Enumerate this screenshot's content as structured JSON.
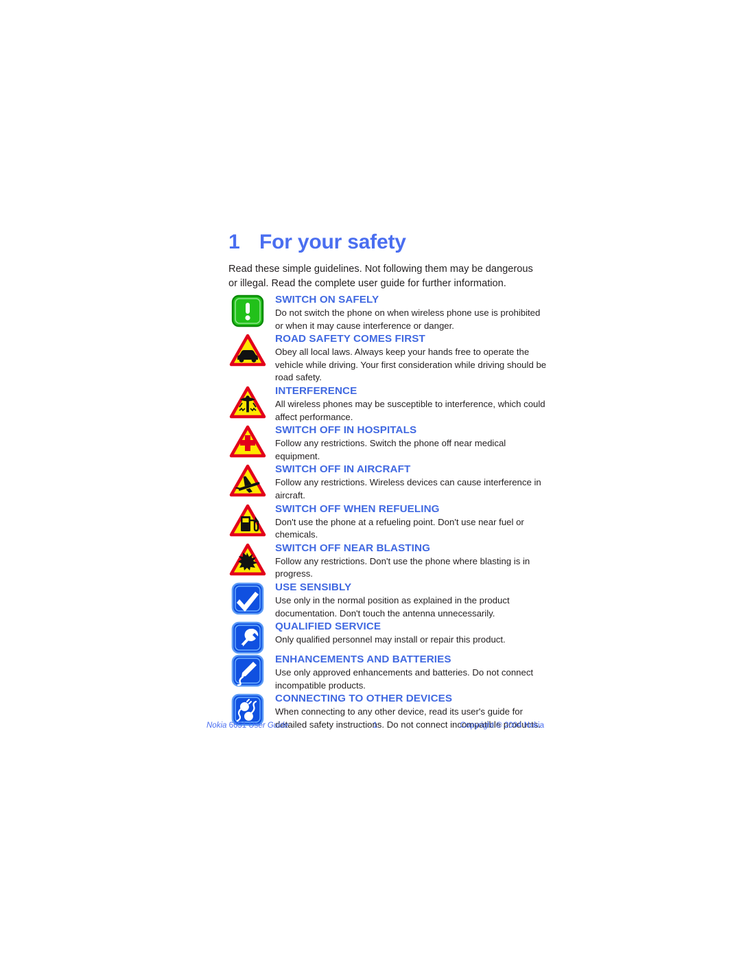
{
  "document": {
    "chapter_number": "1",
    "chapter_title": "For your safety",
    "intro": "Read these simple guidelines. Not following them may be dangerous or illegal. Read the complete user guide for further information."
  },
  "colors": {
    "heading_blue": "#4169e1",
    "title_blue": "#4a6ef0",
    "body_black": "#231f20",
    "warning_yellow": "#ffe600",
    "warning_red": "#e2001a",
    "permit_green": "#22c11a",
    "info_blue": "#1050e0",
    "page_white": "#ffffff"
  },
  "safety_items": [
    {
      "icon": "switch-on-safely-icon",
      "icon_shape": "green-square-exclamation",
      "heading": "SWITCH ON SAFELY",
      "body": "Do not switch the phone on when wireless phone use is prohibited or when it may cause interference or danger."
    },
    {
      "icon": "road-safety-icon",
      "icon_shape": "yellow-triangle-car",
      "heading": "ROAD SAFETY COMES FIRST",
      "body": "Obey all local laws. Always keep your hands free to operate the vehicle while driving. Your first consideration while driving should be road safety."
    },
    {
      "icon": "interference-icon",
      "icon_shape": "yellow-triangle-antenna",
      "heading": "INTERFERENCE",
      "body": "All wireless phones may be susceptible to interference, which could affect performance."
    },
    {
      "icon": "switch-off-hospitals-icon",
      "icon_shape": "yellow-triangle-cross",
      "heading": "SWITCH OFF IN HOSPITALS",
      "body": "Follow any restrictions. Switch the phone off near medical equipment."
    },
    {
      "icon": "switch-off-aircraft-icon",
      "icon_shape": "yellow-triangle-airplane",
      "heading": "SWITCH OFF IN AIRCRAFT",
      "body": "Follow any restrictions. Wireless devices can cause interference in aircraft."
    },
    {
      "icon": "switch-off-refueling-icon",
      "icon_shape": "yellow-triangle-fuelpump",
      "heading": "SWITCH OFF WHEN REFUELING",
      "body": "Don't use the phone at a refueling point. Don't use near fuel or chemicals."
    },
    {
      "icon": "switch-off-blasting-icon",
      "icon_shape": "yellow-triangle-explosion",
      "heading": "SWITCH OFF NEAR BLASTING",
      "body": "Follow any restrictions. Don't use the phone where blasting is in progress."
    },
    {
      "icon": "use-sensibly-icon",
      "icon_shape": "blue-square-checkmark",
      "heading": "USE SENSIBLY",
      "body": "Use only in the normal position as explained in the product documentation. Don't touch the antenna unnecessarily."
    },
    {
      "icon": "qualified-service-icon",
      "icon_shape": "blue-square-wrench",
      "heading": "QUALIFIED SERVICE",
      "body": "Only qualified personnel may install or repair this product."
    },
    {
      "icon": "enhancements-batteries-icon",
      "icon_shape": "blue-square-charger",
      "heading": "ENHANCEMENTS AND BATTERIES",
      "body": "Use only approved enhancements and batteries. Do not connect incompatible products."
    },
    {
      "icon": "connecting-devices-icon",
      "icon_shape": "blue-square-plugs",
      "heading": "CONNECTING TO OTHER DEVICES",
      "body": "When connecting to any other device, read its user's guide for detailed safety instructions. Do not connect incompatible products."
    }
  ],
  "footer": {
    "left_brand": "Nokia ",
    "left_model": "6651 ",
    "left_guide": "User Guide",
    "page_number": "1",
    "copyright": "Copyright © 2004 Nokia"
  }
}
